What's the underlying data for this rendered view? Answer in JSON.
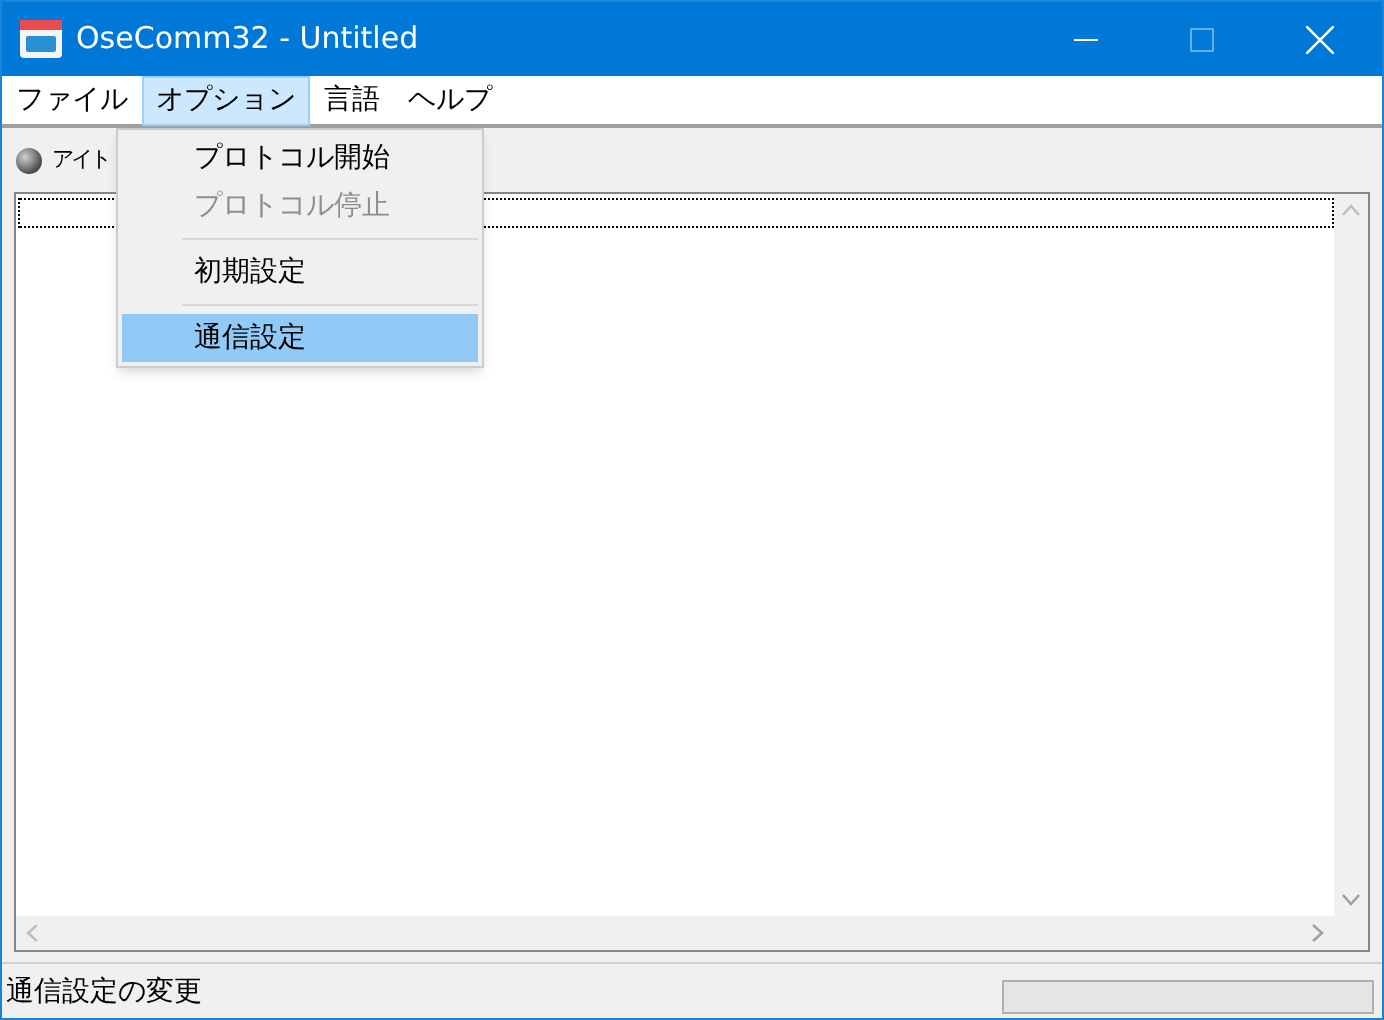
{
  "window": {
    "title": "OseComm32 - Untitled"
  },
  "menu_bar": [
    {
      "label": "ファイル",
      "selected": false
    },
    {
      "label": "オプション",
      "selected": true
    },
    {
      "label": "言語",
      "selected": false
    },
    {
      "label": "ヘルプ",
      "selected": false
    }
  ],
  "dropdown": [
    {
      "kind": "item",
      "label": "プロトコル開始",
      "disabled": false,
      "selected": false
    },
    {
      "kind": "item",
      "label": "プロトコル停止",
      "disabled": true,
      "selected": false
    },
    {
      "kind": "separator"
    },
    {
      "kind": "item",
      "label": "初期設定",
      "disabled": false,
      "selected": false
    },
    {
      "kind": "separator"
    },
    {
      "kind": "item",
      "label": "通信設定",
      "disabled": false,
      "selected": true
    }
  ],
  "toolbar": {
    "label": "アイト"
  },
  "status_bar": {
    "text": "通信設定の変更"
  }
}
